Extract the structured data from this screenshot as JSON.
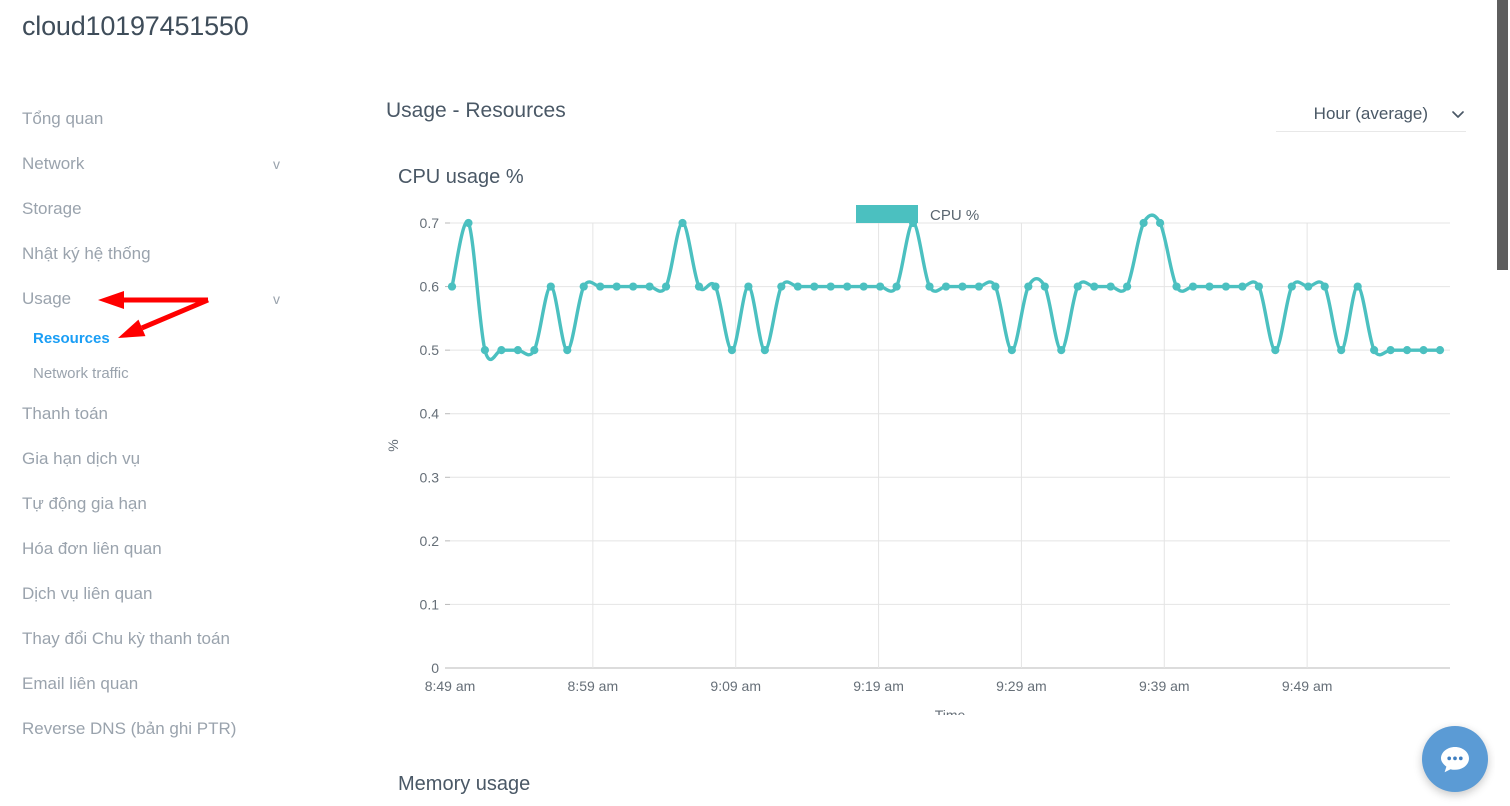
{
  "page": {
    "title": "cloud10197451550"
  },
  "sidebar": {
    "items": [
      {
        "label": "Tổng quan",
        "chevron": "",
        "sub": []
      },
      {
        "label": "Network",
        "chevron": "v",
        "sub": []
      },
      {
        "label": "Storage",
        "chevron": "",
        "sub": []
      },
      {
        "label": "Nhật ký hệ thống",
        "chevron": "",
        "sub": []
      },
      {
        "label": "Usage",
        "chevron": "v",
        "sub": [
          {
            "label": "Resources",
            "active": true
          },
          {
            "label": "Network traffic",
            "active": false
          }
        ]
      },
      {
        "label": "Thanh toán",
        "chevron": "",
        "sub": []
      },
      {
        "label": "Gia hạn dịch vụ",
        "chevron": "",
        "sub": []
      },
      {
        "label": "Tự động gia hạn",
        "chevron": "",
        "sub": []
      },
      {
        "label": "Hóa đơn liên quan",
        "chevron": "",
        "sub": []
      },
      {
        "label": "Dịch vụ liên quan",
        "chevron": "",
        "sub": []
      },
      {
        "label": "Thay đổi Chu kỳ thanh toán",
        "chevron": "",
        "sub": []
      },
      {
        "label": "Email liên quan",
        "chevron": "",
        "sub": []
      },
      {
        "label": "Reverse DNS (bản ghi PTR)",
        "chevron": "",
        "sub": []
      }
    ]
  },
  "main": {
    "section_title": "Usage - Resources",
    "range_select": {
      "value": "Hour (average)",
      "icon": "chevron-down-icon"
    },
    "memory_heading": "Memory usage"
  },
  "chat_widget": {
    "icon": "chat-bubble-icon",
    "color": "#5b9bd5"
  },
  "annotations": {
    "color": "#ff0000",
    "arrows": [
      {
        "name": "arrow-to-usage",
        "from": [
          208,
          300
        ],
        "to": [
          98,
          300
        ]
      },
      {
        "name": "arrow-to-resources",
        "from": [
          208,
          300
        ],
        "to": [
          118,
          338
        ]
      }
    ]
  },
  "chart_data": {
    "type": "line",
    "title": "CPU usage %",
    "xlabel": "Time",
    "ylabel": "%",
    "ylim": [
      0,
      0.7
    ],
    "yticks": [
      0,
      0.1,
      0.2,
      0.3,
      0.4,
      0.5,
      0.6,
      0.7
    ],
    "ytick_labels": [
      "0",
      "0.1",
      "0.2",
      "0.3",
      "0.4",
      "0.5",
      "0.6",
      "0.7"
    ],
    "xticks": [
      "8:49 am",
      "8:59 am",
      "9:09 am",
      "9:19 am",
      "9:29 am",
      "9:39 am",
      "9:49 am"
    ],
    "grid": true,
    "legend": {
      "position": "top-center",
      "entries": [
        "CPU %"
      ]
    },
    "series": [
      {
        "name": "CPU %",
        "color": "#4bc0c0",
        "values": [
          0.6,
          0.7,
          0.5,
          0.5,
          0.5,
          0.5,
          0.6,
          0.5,
          0.6,
          0.6,
          0.6,
          0.6,
          0.6,
          0.6,
          0.7,
          0.6,
          0.6,
          0.5,
          0.6,
          0.5,
          0.6,
          0.6,
          0.6,
          0.6,
          0.6,
          0.6,
          0.6,
          0.6,
          0.7,
          0.6,
          0.6,
          0.6,
          0.6,
          0.6,
          0.5,
          0.6,
          0.6,
          0.5,
          0.6,
          0.6,
          0.6,
          0.6,
          0.7,
          0.7,
          0.6,
          0.6,
          0.6,
          0.6,
          0.6,
          0.6,
          0.5,
          0.6,
          0.6,
          0.6,
          0.5,
          0.6,
          0.5,
          0.5,
          0.5,
          0.5,
          0.5
        ]
      }
    ]
  }
}
